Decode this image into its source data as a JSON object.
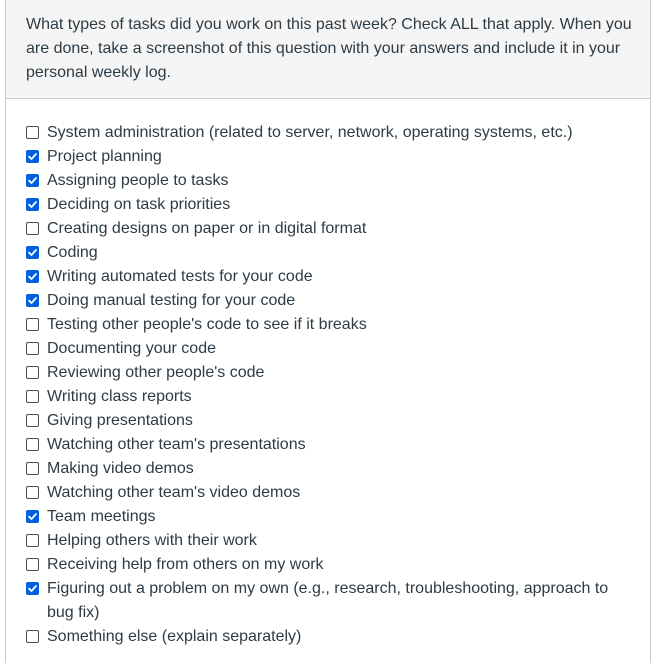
{
  "question": {
    "text": "What types of tasks did you work on this past week? Check ALL that apply. When you are done, take a screenshot of this question with your answers and include it in your personal weekly log."
  },
  "colors": {
    "checked": "#0060df",
    "header_bg": "#f5f5f5",
    "border": "#c7cdd1",
    "text": "#2d3b45"
  },
  "answers": [
    {
      "label": "System administration (related to server, network, operating systems, etc.)",
      "checked": false
    },
    {
      "label": "Project planning",
      "checked": true
    },
    {
      "label": "Assigning people to tasks",
      "checked": true
    },
    {
      "label": "Deciding on task priorities",
      "checked": true
    },
    {
      "label": "Creating designs on paper or in digital format",
      "checked": false
    },
    {
      "label": "Coding",
      "checked": true
    },
    {
      "label": "Writing automated tests for your code",
      "checked": true
    },
    {
      "label": "Doing manual testing for your code",
      "checked": true
    },
    {
      "label": "Testing other people's code to see if it breaks",
      "checked": false
    },
    {
      "label": "Documenting your code",
      "checked": false
    },
    {
      "label": "Reviewing other people's code",
      "checked": false
    },
    {
      "label": "Writing class reports",
      "checked": false
    },
    {
      "label": "Giving presentations",
      "checked": false
    },
    {
      "label": "Watching other team's presentations",
      "checked": false
    },
    {
      "label": "Making video demos",
      "checked": false
    },
    {
      "label": "Watching other team's video demos",
      "checked": false
    },
    {
      "label": "Team meetings",
      "checked": true
    },
    {
      "label": "Helping others with their work",
      "checked": false
    },
    {
      "label": "Receiving help from others on my work",
      "checked": false
    },
    {
      "label": "Figuring out a problem on my own (e.g., research, troubleshooting, approach to bug fix)",
      "checked": true
    },
    {
      "label": "Something else (explain separately)",
      "checked": false
    }
  ]
}
